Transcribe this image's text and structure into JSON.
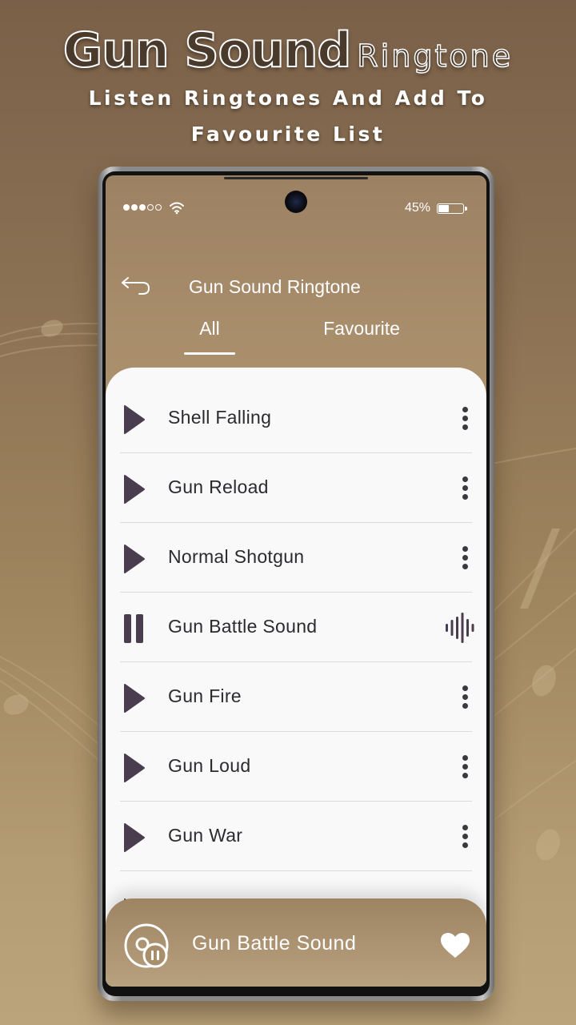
{
  "promo": {
    "title_bold": "Gun Sound",
    "title_light": "Ringtone",
    "subtitle_line1": "Listen Ringtones And Add To",
    "subtitle_line2": "Favourite List"
  },
  "status_bar": {
    "signal_bars_filled": 3,
    "signal_bars_total": 5,
    "wifi_icon": "wifi-icon",
    "battery_percent_label": "45%",
    "battery_level": 0.45
  },
  "header": {
    "back_icon": "back-arrow-icon",
    "title": "Gun Sound Ringtone"
  },
  "tabs": [
    {
      "label": "All",
      "active": true
    },
    {
      "label": "Favourite",
      "active": false
    }
  ],
  "ringtones": [
    {
      "name": "Shell Falling",
      "state": "stopped",
      "trailing_icon": "more-vertical-icon"
    },
    {
      "name": "Gun Reload",
      "state": "stopped",
      "trailing_icon": "more-vertical-icon"
    },
    {
      "name": "Normal Shotgun",
      "state": "stopped",
      "trailing_icon": "more-vertical-icon"
    },
    {
      "name": "Gun Battle Sound",
      "state": "playing",
      "trailing_icon": "sound-wave-icon"
    },
    {
      "name": "Gun Fire",
      "state": "stopped",
      "trailing_icon": "more-vertical-icon"
    },
    {
      "name": "Gun Loud",
      "state": "stopped",
      "trailing_icon": "more-vertical-icon"
    },
    {
      "name": "Gun War",
      "state": "stopped",
      "trailing_icon": "more-vertical-icon"
    }
  ],
  "now_playing": {
    "title": "Gun Battle Sound",
    "control_icon": "disc-pause-icon",
    "favourite_icon": "heart-icon",
    "favourited": true
  },
  "colors": {
    "accent_brown": "#a98e6c",
    "icon_dark": "#4a3d4f",
    "list_bg": "#f9f9f9",
    "text_dark": "#2c2a2e"
  }
}
